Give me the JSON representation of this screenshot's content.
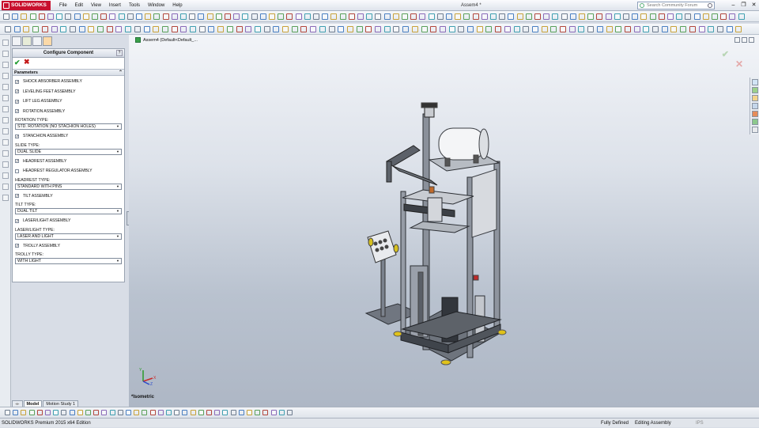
{
  "app": {
    "logo_text": "SOLIDWORKS",
    "document_title": "Assem4 *",
    "menu": [
      "File",
      "Edit",
      "View",
      "Insert",
      "Tools",
      "Window",
      "Help"
    ],
    "search_placeholder": "Search Community Forum"
  },
  "panel": {
    "title": "Configure Component",
    "help_label": "?",
    "ok_symbol": "✔",
    "cancel_symbol": "✖",
    "section": "Parameters",
    "collapse_symbol": "⌃",
    "rows": [
      {
        "kind": "check",
        "label": "SHOCK ABSORBER ASSEMBLY",
        "checked": true
      },
      {
        "kind": "check",
        "label": "LEVELING FEET ASSEMBLY",
        "checked": true
      },
      {
        "kind": "check",
        "label": "LIFT LEG ASSEMBLY",
        "checked": true
      },
      {
        "kind": "check",
        "label": "ROTATION ASSEMBLY",
        "checked": true
      },
      {
        "kind": "label",
        "label": "ROTATION TYPE:"
      },
      {
        "kind": "select",
        "value": "STD. ROTATION (NO STACHION HOLES)"
      },
      {
        "kind": "check",
        "label": "STANCHION ASSEMBLY",
        "checked": true
      },
      {
        "kind": "label",
        "label": "SLIDE TYPE:"
      },
      {
        "kind": "select",
        "value": "DUAL SLIDE"
      },
      {
        "kind": "check",
        "label": "HEADREST ASSEMBLY",
        "checked": true
      },
      {
        "kind": "check",
        "label": "HEADREST REGULATOR ASSEMBLY",
        "checked": false
      },
      {
        "kind": "label",
        "label": "HEADREST TYPE:"
      },
      {
        "kind": "select",
        "value": "STANDARD WITH PINS"
      },
      {
        "kind": "check",
        "label": "TILT ASSEMBLY",
        "checked": true
      },
      {
        "kind": "label",
        "label": "TILT TYPE:"
      },
      {
        "kind": "select",
        "value": "DUAL TILT"
      },
      {
        "kind": "check",
        "label": "LASER/LIGHT ASSEMBLY",
        "checked": true
      },
      {
        "kind": "label",
        "label": "LASER/LIGHT TYPE:"
      },
      {
        "kind": "select",
        "value": "LASER AND LIGHT"
      },
      {
        "kind": "check",
        "label": "TROLLY ASSEMBLY",
        "checked": true
      },
      {
        "kind": "label",
        "label": "TROLLY TYPE:"
      },
      {
        "kind": "select",
        "value": "WITH LIGHT"
      }
    ]
  },
  "viewport": {
    "tree_label": "Assem4 (Default<Default_...",
    "view_name": "*Isometric",
    "triad_axes": [
      "Y",
      "X",
      "Z"
    ]
  },
  "bottom_tabs": [
    "Model",
    "Motion Study 1"
  ],
  "status": {
    "edition": "SOLIDWORKS Premium 2015 x64 Edition",
    "definition": "Fully Defined",
    "mode": "Editing Assembly",
    "units": "IPS"
  },
  "colors": {
    "accent": "#c8102e",
    "ok": "#1e9b2e",
    "cancel": "#c41818",
    "viewport_top": "#f2f4f8",
    "viewport_bottom": "#aeb7c5"
  }
}
